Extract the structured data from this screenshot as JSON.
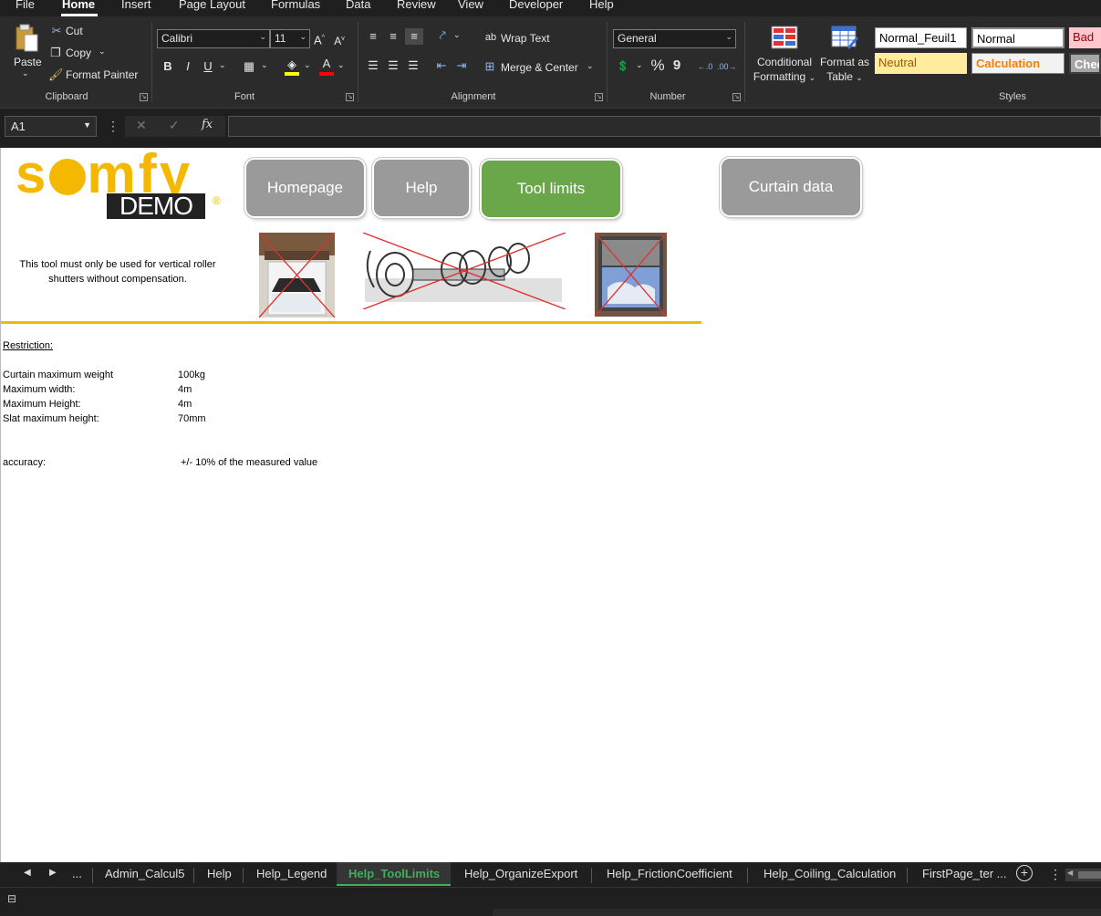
{
  "ribbon_tabs": [
    "File",
    "Home",
    "Insert",
    "Page Layout",
    "Formulas",
    "Data",
    "Review",
    "View",
    "Developer",
    "Help"
  ],
  "active_tab": "Home",
  "clipboard": {
    "paste": "Paste",
    "cut": "Cut",
    "copy": "Copy",
    "format_painter": "Format Painter",
    "label": "Clipboard"
  },
  "font": {
    "name": "Calibri",
    "size": "11",
    "label": "Font",
    "bold": "B",
    "italic": "I",
    "underline": "U",
    "font_color": "#ff0000",
    "highlight_color": "#ffff00"
  },
  "alignment": {
    "wrap_text": "Wrap Text",
    "merge_center": "Merge & Center",
    "label": "Alignment"
  },
  "number": {
    "format": "General",
    "percent": "%",
    "comma": "9",
    "label": "Number"
  },
  "styles": {
    "conditional_formatting_line1": "Conditional",
    "conditional_formatting_line2": "Formatting",
    "format_as_table_line1": "Format as",
    "format_as_table_line2": "Table",
    "label": "Styles",
    "cells": [
      {
        "label": "Normal_Feuil1",
        "bg": "#ffffff",
        "fg": "#000000"
      },
      {
        "label": "Normal",
        "bg": "#ffffff",
        "fg": "#000000"
      },
      {
        "label": "Bad",
        "bg": "#ffc7ce",
        "fg": "#9c0006"
      },
      {
        "label": "Neutral",
        "bg": "#ffeb9c",
        "fg": "#9c5700"
      },
      {
        "label": "Calculation",
        "bg": "#f2f2f2",
        "fg": "#fa7d00"
      },
      {
        "label": "Chec",
        "bg": "#a5a5a5",
        "fg": "#ffffff"
      }
    ]
  },
  "formula_bar": {
    "name_box": "A1",
    "fx": "fx",
    "formula": ""
  },
  "sheet": {
    "logo_text": "somfy",
    "logo_sub": "DEMO",
    "logo_reg": "®",
    "buttons": {
      "homepage": "Homepage",
      "help": "Help",
      "tool_limits": "Tool limits",
      "curtain_data": "Curtain data"
    },
    "notice": "This tool must only be used for vertical roller shutters without compensation.",
    "restriction_title": "Restriction:",
    "restrictions": [
      {
        "label": "Curtain maximum weight",
        "value": "100kg"
      },
      {
        "label": "Maximum width:",
        "value": "4m"
      },
      {
        "label": "Maximum Height:",
        "value": "4m"
      },
      {
        "label": "Slat maximum height:",
        "value": "70mm"
      }
    ],
    "accuracy_label": "accuracy:",
    "accuracy_value": "+/- 10% of the measured value",
    "accent_color": "#f5b800",
    "active_button_color": "#6aa64a"
  },
  "sheet_tabs": {
    "more": "...",
    "tabs": [
      "Admin_Calcul5",
      "Help",
      "Help_Legend",
      "Help_ToolLimits",
      "Help_OrganizeExport",
      "Help_FrictionCoefficient",
      "Help_Coiling_Calculation",
      "FirstPage_ter ..."
    ],
    "active": "Help_ToolLimits"
  }
}
